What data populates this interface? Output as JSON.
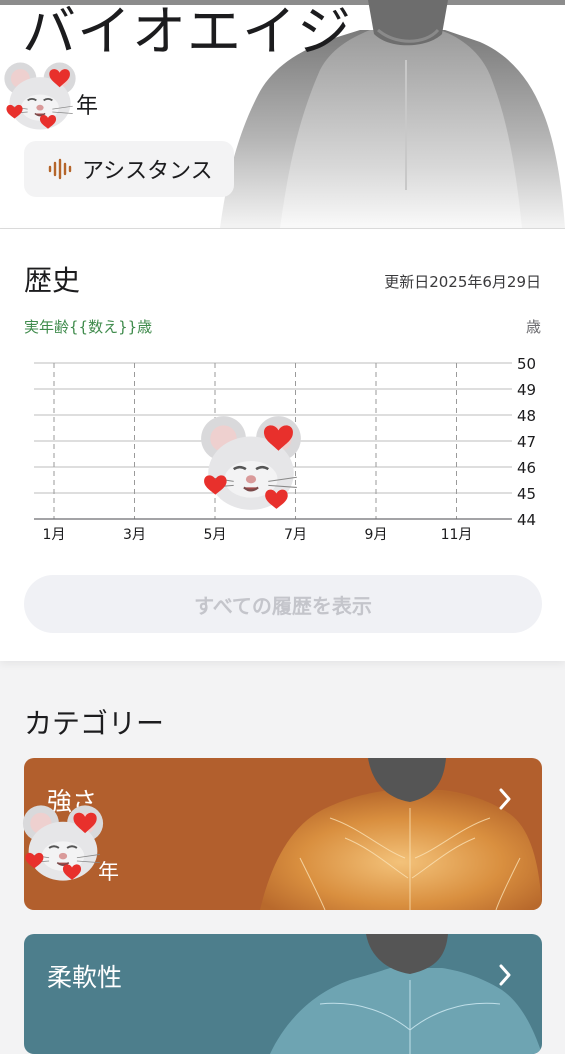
{
  "header": {
    "title": "バイオエイジ",
    "year_unit": "年",
    "assistance_label": "アシスタンス"
  },
  "history": {
    "title": "歴史",
    "updated": "更新日2025年6月29日",
    "real_age": "実年齢{{数え}}歳",
    "unit": "歳",
    "show_all": "すべての履歴を表示"
  },
  "chart_data": {
    "type": "line",
    "title": "",
    "xlabel": "",
    "ylabel": "歳",
    "x_ticks": [
      "1月",
      "3月",
      "5月",
      "7月",
      "9月",
      "11月"
    ],
    "y_ticks": [
      44,
      45,
      46,
      47,
      48,
      49,
      50
    ],
    "ylim": [
      44,
      50
    ],
    "grid": true,
    "series": []
  },
  "categories": {
    "title": "カテゴリー",
    "items": [
      {
        "label": "強さ",
        "year_unit": "年",
        "color": "#b25f2d"
      },
      {
        "label": "柔軟性",
        "color": "#4d7e8c"
      }
    ]
  },
  "colors": {
    "accent_green": "#3f8b4c",
    "assist_icon": "#b5652a"
  }
}
